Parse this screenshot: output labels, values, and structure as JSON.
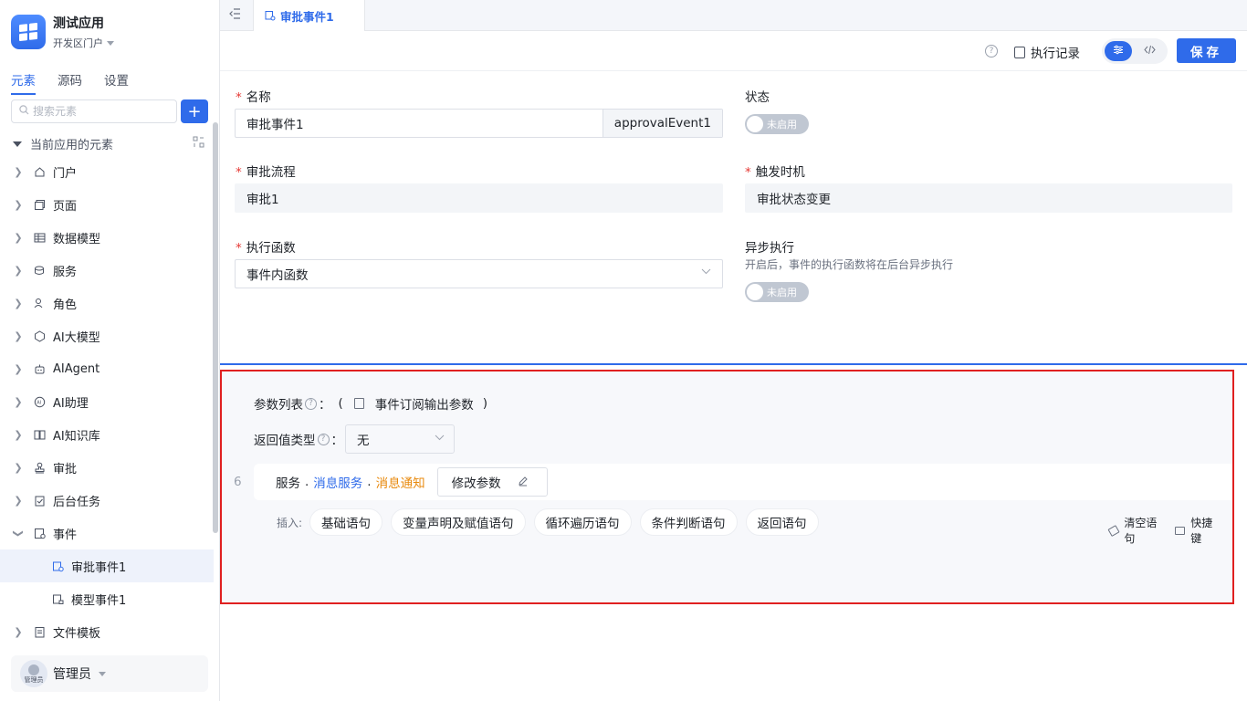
{
  "app": {
    "name": "测试应用",
    "portal": "开发区门户"
  },
  "side_tabs": [
    "元素",
    "源码",
    "设置"
  ],
  "search": {
    "placeholder": "搜索元素"
  },
  "tree": {
    "header": "当前应用的元素",
    "items": [
      {
        "label": "门户",
        "icon": "home-icon"
      },
      {
        "label": "页面",
        "icon": "page-icon"
      },
      {
        "label": "数据模型",
        "icon": "table-icon"
      },
      {
        "label": "服务",
        "icon": "service-icon"
      },
      {
        "label": "角色",
        "icon": "role-icon"
      },
      {
        "label": "AI大模型",
        "icon": "ai-model-icon"
      },
      {
        "label": "AIAgent",
        "icon": "robot-icon"
      },
      {
        "label": "AI助理",
        "icon": "ai-assistant-icon"
      },
      {
        "label": "AI知识库",
        "icon": "book-icon"
      },
      {
        "label": "审批",
        "icon": "stamp-icon"
      },
      {
        "label": "后台任务",
        "icon": "task-icon"
      },
      {
        "label": "事件",
        "icon": "event-icon"
      },
      {
        "label": "审批事件1",
        "icon": "approval-event-icon"
      },
      {
        "label": "模型事件1",
        "icon": "model-event-icon"
      },
      {
        "label": "文件模板",
        "icon": "file-template-icon"
      }
    ]
  },
  "user": {
    "name": "管理员",
    "avatar_text": "管理员"
  },
  "tab": {
    "label": "审批事件1"
  },
  "toolbar": {
    "help": "?",
    "exec_log": "执行记录",
    "save": "保存"
  },
  "form": {
    "name_label": "名称",
    "name_value": "审批事件1",
    "name_code": "approvalEvent1",
    "status_label": "状态",
    "status_toggle": "未启用",
    "flow_label": "审批流程",
    "flow_value": "审批1",
    "trigger_label": "触发时机",
    "trigger_value": "审批状态变更",
    "func_label": "执行函数",
    "func_value": "事件内函数",
    "async_label": "异步执行",
    "async_hint": "开启后，事件的执行函数将在后台异步执行",
    "async_toggle": "未启用"
  },
  "code": {
    "params_label": "参数列表",
    "colon": "：",
    "paren_open": "(",
    "paren_close": ")",
    "param_item": "事件订阅输出参数",
    "return_label": "返回值类型",
    "return_value": "无",
    "line_no": "6",
    "stmt_part1": "服务",
    "stmt_part2": "消息服务",
    "stmt_part3": "消息通知",
    "dot": ".",
    "edit_params": "修改参数",
    "insert_label": "插入:",
    "insert_chips": [
      "基础语句",
      "变量声明及赋值语句",
      "循环遍历语句",
      "条件判断语句",
      "返回语句"
    ],
    "clear": "清空语句",
    "shortcut": "快捷键"
  },
  "colors": {
    "accent": "#2f6bea",
    "required": "#e53935",
    "highlight_border": "#e02020",
    "orange": "#e8890c"
  }
}
